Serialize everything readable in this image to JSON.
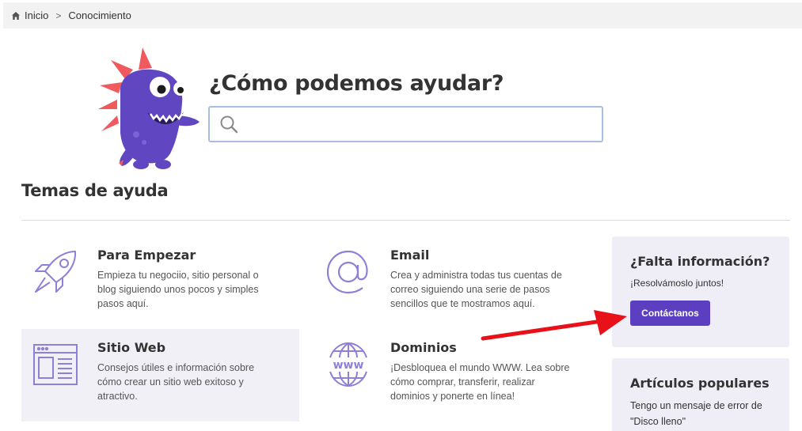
{
  "breadcrumb": {
    "items": [
      {
        "label": "Inicio",
        "icon": "home-icon"
      },
      {
        "label": "Conocimiento"
      }
    ],
    "separator": ">"
  },
  "hero": {
    "title": "¿Cómo podemos ayudar?",
    "search": {
      "value": "",
      "placeholder": "",
      "icon": "search-icon"
    }
  },
  "topics_title": "Temas de ayuda",
  "topics": [
    {
      "title": "Para Empezar",
      "description": "Empieza tu negociio, sitio personal o blog siguiendo unos pocos y simples pasos aquí.",
      "icon": "rocket-icon"
    },
    {
      "title": "Email",
      "description": "Crea y administra todas tus cuentas de correo siguiendo una serie de pasos sencillos que te mostramos aquí.",
      "icon": "at-sign-icon"
    },
    {
      "title": "Sitio Web",
      "description": "Consejos útiles e información sobre cómo crear un sitio web exitoso y atractivo.",
      "icon": "webpage-layout-icon"
    },
    {
      "title": "Dominios",
      "description": "¡Desbloquea el mundo WWW. Lea sobre cómo comprar, transferir, realizar dominios y ponerte en línea!",
      "icon": "www-globe-icon"
    }
  ],
  "missing_info": {
    "title": "¿Falta información?",
    "subtitle": "¡Resolvámoslo juntos!",
    "button_label": "Contáctanos"
  },
  "popular": {
    "title": "Artículos populares",
    "first_article": "Tengo un mensaje de error de \"Disco lleno\""
  },
  "colors": {
    "accent": "#5b3fc0",
    "icon_stroke": "#8f7fd6",
    "card_shade": "#f1f0f7",
    "panel_bg": "#efeef7",
    "annotation_arrow": "#e8111a"
  }
}
